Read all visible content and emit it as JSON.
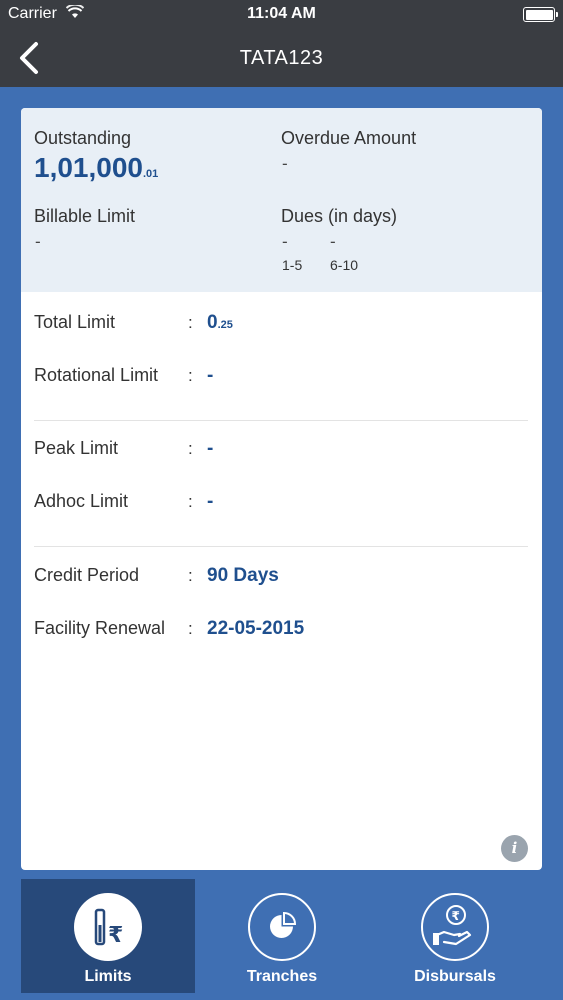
{
  "status_bar": {
    "carrier": "Carrier",
    "time": "11:04 AM"
  },
  "nav": {
    "title": "TATA123"
  },
  "summary": {
    "outstanding_label": "Outstanding",
    "outstanding_main": "1,01,000",
    "outstanding_decimal": ".01",
    "overdue_label": "Overdue Amount",
    "overdue_value": "-",
    "billable_label": "Billable Limit",
    "billable_value": "-",
    "dues_label": "Dues (in days)",
    "dues": [
      {
        "value": "-",
        "range": "1-5"
      },
      {
        "value": "-",
        "range": "6-10"
      }
    ]
  },
  "limits": {
    "total": {
      "label": "Total Limit",
      "main": "0",
      "decimal": ".25"
    },
    "rotational": {
      "label": "Rotational Limit",
      "value": "-"
    },
    "peak": {
      "label": "Peak Limit",
      "value": "-"
    },
    "adhoc": {
      "label": "Adhoc Limit",
      "value": "-"
    },
    "credit_period": {
      "label": "Credit Period",
      "value": "90 Days"
    },
    "facility_renewal": {
      "label": "Facility Renewal",
      "value": "22-05-2015"
    },
    "separator": ":"
  },
  "info_button": {
    "glyph": "i"
  },
  "tabs": [
    {
      "label": "Limits",
      "icon": "limits-rupee-icon",
      "active": true
    },
    {
      "label": "Tranches",
      "icon": "pie-chart-icon",
      "active": false
    },
    {
      "label": "Disbursals",
      "icon": "hand-rupee-icon",
      "active": false
    }
  ],
  "colors": {
    "nav_bg": "#3a3d42",
    "page_bg": "#3f6fb3",
    "accent_text": "#1f4f8e",
    "summary_bg": "#e8eff6",
    "active_tab_bg": "#27497a"
  }
}
